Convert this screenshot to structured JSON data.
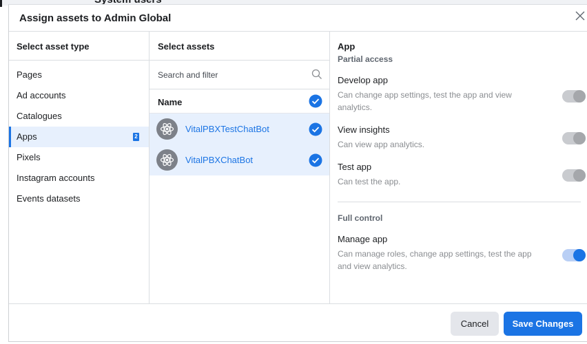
{
  "background": {
    "title": "System users"
  },
  "dialog": {
    "title": "Assign assets to Admin Global",
    "close_icon": "close-icon"
  },
  "asset_types": {
    "header": "Select asset type",
    "items": [
      {
        "label": "Pages"
      },
      {
        "label": "Ad accounts"
      },
      {
        "label": "Catalogues"
      },
      {
        "label": "Apps",
        "badge": "2",
        "active": true
      },
      {
        "label": "Pixels"
      },
      {
        "label": "Instagram accounts"
      },
      {
        "label": "Events datasets"
      }
    ]
  },
  "assets": {
    "header": "Select assets",
    "search_placeholder": "Search and filter",
    "search_icon": "search-icon",
    "name_header": "Name",
    "rows": [
      {
        "label": "VitalPBXTestChatBot",
        "icon": "app-atom-icon",
        "checked": true
      },
      {
        "label": "VitalPBXChatBot",
        "icon": "app-atom-icon",
        "checked": true
      }
    ]
  },
  "permissions": {
    "title": "App",
    "subtitle": "Partial access",
    "partial": [
      {
        "name": "Develop app",
        "desc": "Can change app settings, test the app and view analytics.",
        "enabled": true
      },
      {
        "name": "View insights",
        "desc": "Can view app analytics.",
        "enabled": true
      },
      {
        "name": "Test app",
        "desc": "Can test the app.",
        "enabled": true
      }
    ],
    "full_header": "Full control",
    "full": [
      {
        "name": "Manage app",
        "desc": "Can manage roles, change app settings, test the app and view analytics.",
        "enabled": true
      }
    ]
  },
  "footer": {
    "cancel_label": "Cancel",
    "save_label": "Save Changes"
  },
  "colors": {
    "accent": "#1b74e4",
    "selected_bg": "#e7f0fd",
    "toggle_disabled": "#c9cbcf"
  }
}
